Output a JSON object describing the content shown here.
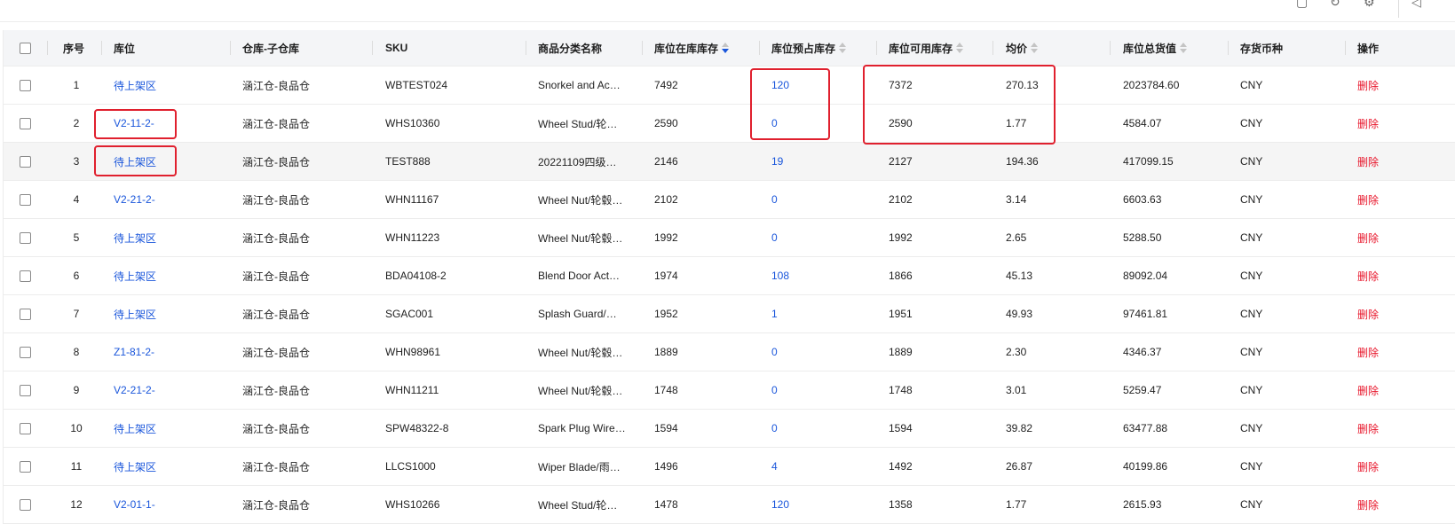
{
  "topbar": {
    "icons": [
      "export-icon",
      "refresh-icon",
      "settings-icon",
      "panel-icon"
    ]
  },
  "columns": {
    "select_all": "",
    "index": "序号",
    "location": "库位",
    "warehouse": "仓库-子仓库",
    "sku": "SKU",
    "category": "商品分类名称",
    "in_stock": "库位在库库存",
    "reserved": "库位预占库存",
    "available": "库位可用库存",
    "avg_price": "均价",
    "total_value": "库位总货值",
    "currency": "存货币种",
    "actions": "操作"
  },
  "rows": [
    {
      "index": "1",
      "location": "待上架区",
      "warehouse": "涵江仓-良品仓",
      "sku": "WBTEST024",
      "category": "Snorkel and Ac…",
      "in_stock": "7492",
      "reserved": "120",
      "available": "7372",
      "avg_price": "270.13",
      "total_value": "2023784.60",
      "currency": "CNY",
      "action": "删除"
    },
    {
      "index": "2",
      "location": "V2-11-2-",
      "warehouse": "涵江仓-良品仓",
      "sku": "WHS10360",
      "category": "Wheel Stud/轮…",
      "in_stock": "2590",
      "reserved": "0",
      "available": "2590",
      "avg_price": "1.77",
      "total_value": "4584.07",
      "currency": "CNY",
      "action": "删除"
    },
    {
      "index": "3",
      "location": "待上架区",
      "warehouse": "涵江仓-良品仓",
      "sku": "TEST888",
      "category": "20221109四级…",
      "in_stock": "2146",
      "reserved": "19",
      "available": "2127",
      "avg_price": "194.36",
      "total_value": "417099.15",
      "currency": "CNY",
      "action": "删除"
    },
    {
      "index": "4",
      "location": "V2-21-2-",
      "warehouse": "涵江仓-良品仓",
      "sku": "WHN11167",
      "category": "Wheel Nut/轮毂…",
      "in_stock": "2102",
      "reserved": "0",
      "available": "2102",
      "avg_price": "3.14",
      "total_value": "6603.63",
      "currency": "CNY",
      "action": "删除"
    },
    {
      "index": "5",
      "location": "待上架区",
      "warehouse": "涵江仓-良品仓",
      "sku": "WHN11223",
      "category": "Wheel Nut/轮毂…",
      "in_stock": "1992",
      "reserved": "0",
      "available": "1992",
      "avg_price": "2.65",
      "total_value": "5288.50",
      "currency": "CNY",
      "action": "删除"
    },
    {
      "index": "6",
      "location": "待上架区",
      "warehouse": "涵江仓-良品仓",
      "sku": "BDA04108-2",
      "category": "Blend Door Act…",
      "in_stock": "1974",
      "reserved": "108",
      "available": "1866",
      "avg_price": "45.13",
      "total_value": "89092.04",
      "currency": "CNY",
      "action": "删除"
    },
    {
      "index": "7",
      "location": "待上架区",
      "warehouse": "涵江仓-良品仓",
      "sku": "SGAC001",
      "category": "Splash Guard/…",
      "in_stock": "1952",
      "reserved": "1",
      "available": "1951",
      "avg_price": "49.93",
      "total_value": "97461.81",
      "currency": "CNY",
      "action": "删除"
    },
    {
      "index": "8",
      "location": "Z1-81-2-",
      "warehouse": "涵江仓-良品仓",
      "sku": "WHN98961",
      "category": "Wheel Nut/轮毂…",
      "in_stock": "1889",
      "reserved": "0",
      "available": "1889",
      "avg_price": "2.30",
      "total_value": "4346.37",
      "currency": "CNY",
      "action": "删除"
    },
    {
      "index": "9",
      "location": "V2-21-2-",
      "warehouse": "涵江仓-良品仓",
      "sku": "WHN11211",
      "category": "Wheel Nut/轮毂…",
      "in_stock": "1748",
      "reserved": "0",
      "available": "1748",
      "avg_price": "3.01",
      "total_value": "5259.47",
      "currency": "CNY",
      "action": "删除"
    },
    {
      "index": "10",
      "location": "待上架区",
      "warehouse": "涵江仓-良品仓",
      "sku": "SPW48322-8",
      "category": "Spark Plug Wire…",
      "in_stock": "1594",
      "reserved": "0",
      "available": "1594",
      "avg_price": "39.82",
      "total_value": "63477.88",
      "currency": "CNY",
      "action": "删除"
    },
    {
      "index": "11",
      "location": "待上架区",
      "warehouse": "涵江仓-良品仓",
      "sku": "LLCS1000",
      "category": "Wiper Blade/雨…",
      "in_stock": "1496",
      "reserved": "4",
      "available": "1492",
      "avg_price": "26.87",
      "total_value": "40199.86",
      "currency": "CNY",
      "action": "删除"
    },
    {
      "index": "12",
      "location": "V2-01-1-",
      "warehouse": "涵江仓-良品仓",
      "sku": "WHS10266",
      "category": "Wheel Stud/轮…",
      "in_stock": "1478",
      "reserved": "120",
      "available": "1358",
      "avg_price": "1.77",
      "total_value": "2615.93",
      "currency": "CNY",
      "action": "删除"
    }
  ],
  "colors": {
    "link": "#1a56db",
    "delete": "#e8152a",
    "annotation": "#e0202e",
    "header_bg": "#f4f5f7"
  }
}
